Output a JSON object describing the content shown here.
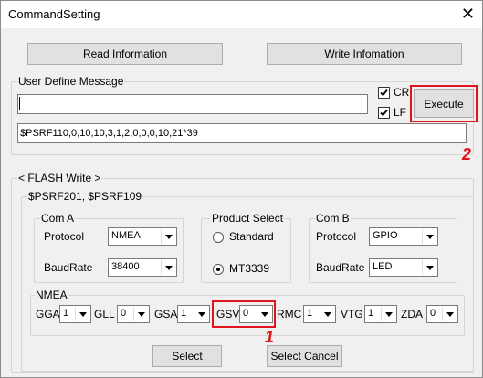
{
  "window": {
    "title": "CommandSetting",
    "close_symbol": "✕"
  },
  "toolbar": {
    "read_label": "Read Information",
    "write_label": "Write Infomation"
  },
  "user_define": {
    "group_label": "User Define Message",
    "message_value": "",
    "cr_label": "CR",
    "cr_checked": true,
    "lf_label": "LF",
    "lf_checked": true,
    "execute_label": "Execute",
    "command_value": "$PSRF110,0,10,10,3,1,2,0,0,0,10,21*39"
  },
  "flash": {
    "group_label": "< FLASH Write >",
    "sub_label": "$PSRF201, $PSRF109",
    "com_a": {
      "label": "Com A",
      "protocol_label": "Protocol",
      "protocol_value": "NMEA",
      "baud_label": "BaudRate",
      "baud_value": "38400"
    },
    "product": {
      "label": "Product Select",
      "standard_label": "Standard",
      "mt_label": "MT3339",
      "selected": "MT3339"
    },
    "com_b": {
      "label": "Com B",
      "protocol_label": "Protocol",
      "protocol_value": "GPIO",
      "baud_label": "BaudRate",
      "baud_value": "LED"
    },
    "nmea": {
      "label": "NMEA",
      "items": [
        {
          "name": "GGA",
          "value": "1"
        },
        {
          "name": "GLL",
          "value": "0"
        },
        {
          "name": "GSA",
          "value": "1"
        },
        {
          "name": "GSV",
          "value": "0"
        },
        {
          "name": "RMC",
          "value": "1"
        },
        {
          "name": "VTG",
          "value": "1"
        },
        {
          "name": "ZDA",
          "value": "0"
        }
      ]
    },
    "select_label": "Select",
    "select_cancel_label": "Select Cancel"
  },
  "annotations": {
    "marker_1": "1",
    "marker_2": "2",
    "color": "#e0151b"
  }
}
